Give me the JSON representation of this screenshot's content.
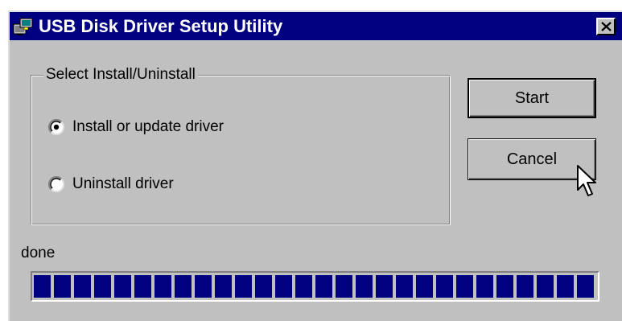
{
  "window": {
    "title": "USB Disk Driver Setup Utility",
    "close_label": "close",
    "icon": "usb-drive-icon"
  },
  "group": {
    "label": "Select Install/Uninstall",
    "options": [
      {
        "label": "Install or update driver",
        "selected": true
      },
      {
        "label": "Uninstall driver",
        "selected": false
      }
    ]
  },
  "buttons": {
    "start": "Start",
    "cancel": "Cancel"
  },
  "status": {
    "text": "done",
    "progress_percent": 100
  },
  "colors": {
    "titlebar": "#000080",
    "face": "#c0c0c0",
    "progress": "#000080"
  }
}
